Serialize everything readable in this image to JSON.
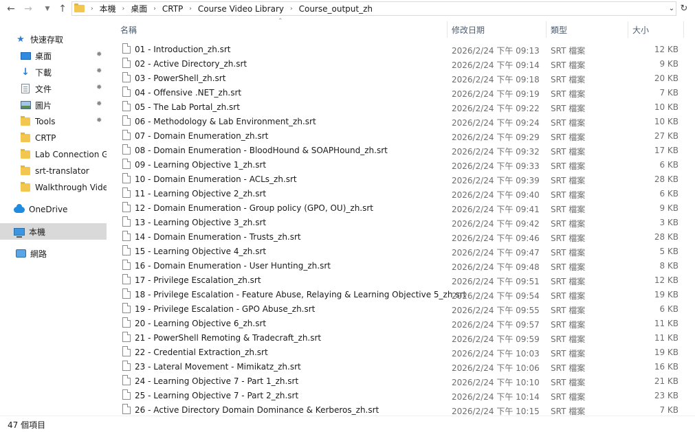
{
  "address_bar": {
    "back_icon": "arrow-left-icon",
    "forward_icon": "arrow-right-icon",
    "recent_icon": "chevron-down-icon",
    "up_icon": "arrow-up-icon",
    "breadcrumbs": [
      "本機",
      "桌面",
      "CRTP",
      "Course Video Library",
      "Course_output_zh"
    ]
  },
  "sidebar": {
    "items": [
      {
        "label": "快速存取",
        "icon": "star-icon",
        "pinned": false
      },
      {
        "label": "桌面",
        "icon": "desktop-icon",
        "pinned": true
      },
      {
        "label": "下載",
        "icon": "download-icon",
        "pinned": true
      },
      {
        "label": "文件",
        "icon": "documents-icon",
        "pinned": true
      },
      {
        "label": "圖片",
        "icon": "pictures-icon",
        "pinned": true
      },
      {
        "label": "Tools",
        "icon": "folder-icon",
        "pinned": true
      },
      {
        "label": "CRTP",
        "icon": "folder-icon",
        "pinned": false
      },
      {
        "label": "Lab Connection Gu",
        "icon": "folder-icon",
        "pinned": false
      },
      {
        "label": "srt-translator",
        "icon": "folder-icon",
        "pinned": false
      },
      {
        "label": "Walkthrough Vide",
        "icon": "folder-icon",
        "pinned": false
      },
      {
        "label": "OneDrive",
        "icon": "onedrive-icon",
        "pinned": false
      },
      {
        "label": "本機",
        "icon": "this-pc-icon",
        "pinned": false,
        "selected": true
      },
      {
        "label": "網路",
        "icon": "network-icon",
        "pinned": false
      }
    ]
  },
  "columns": {
    "name": "名稱",
    "modified": "修改日期",
    "type": "類型",
    "size": "大小"
  },
  "files": [
    {
      "name": "01 - Introduction_zh.srt",
      "modified": "2026/2/24 下午 09:13",
      "type": "SRT 檔案",
      "size": "12 KB"
    },
    {
      "name": "02 - Active Directory_zh.srt",
      "modified": "2026/2/24 下午 09:14",
      "type": "SRT 檔案",
      "size": "9 KB"
    },
    {
      "name": "03 - PowerShell_zh.srt",
      "modified": "2026/2/24 下午 09:18",
      "type": "SRT 檔案",
      "size": "20 KB"
    },
    {
      "name": "04 - Offensive .NET_zh.srt",
      "modified": "2026/2/24 下午 09:19",
      "type": "SRT 檔案",
      "size": "7 KB"
    },
    {
      "name": "05 - The Lab Portal_zh.srt",
      "modified": "2026/2/24 下午 09:22",
      "type": "SRT 檔案",
      "size": "10 KB"
    },
    {
      "name": "06 - Methodology & Lab Environment_zh.srt",
      "modified": "2026/2/24 下午 09:24",
      "type": "SRT 檔案",
      "size": "10 KB"
    },
    {
      "name": "07 - Domain Enumeration_zh.srt",
      "modified": "2026/2/24 下午 09:29",
      "type": "SRT 檔案",
      "size": "27 KB"
    },
    {
      "name": "08 - Domain Enumeration - BloodHound & SOAPHound_zh.srt",
      "modified": "2026/2/24 下午 09:32",
      "type": "SRT 檔案",
      "size": "17 KB"
    },
    {
      "name": "09 - Learning Objective 1_zh.srt",
      "modified": "2026/2/24 下午 09:33",
      "type": "SRT 檔案",
      "size": "6 KB"
    },
    {
      "name": "10 - Domain Enumeration - ACLs_zh.srt",
      "modified": "2026/2/24 下午 09:39",
      "type": "SRT 檔案",
      "size": "28 KB"
    },
    {
      "name": "11 - Learning Objective 2_zh.srt",
      "modified": "2026/2/24 下午 09:40",
      "type": "SRT 檔案",
      "size": "6 KB"
    },
    {
      "name": "12 - Domain Enumeration - Group policy (GPO, OU)_zh.srt",
      "modified": "2026/2/24 下午 09:41",
      "type": "SRT 檔案",
      "size": "9 KB"
    },
    {
      "name": "13 - Learning Objective 3_zh.srt",
      "modified": "2026/2/24 下午 09:42",
      "type": "SRT 檔案",
      "size": "3 KB"
    },
    {
      "name": "14 - Domain Enumeration - Trusts_zh.srt",
      "modified": "2026/2/24 下午 09:46",
      "type": "SRT 檔案",
      "size": "28 KB"
    },
    {
      "name": "15 - Learning Objective 4_zh.srt",
      "modified": "2026/2/24 下午 09:47",
      "type": "SRT 檔案",
      "size": "5 KB"
    },
    {
      "name": "16 - Domain Enumeration - User Hunting_zh.srt",
      "modified": "2026/2/24 下午 09:48",
      "type": "SRT 檔案",
      "size": "8 KB"
    },
    {
      "name": "17 - Privilege Escalation_zh.srt",
      "modified": "2026/2/24 下午 09:51",
      "type": "SRT 檔案",
      "size": "12 KB"
    },
    {
      "name": "18 - Privilege Escalation - Feature Abuse, Relaying & Learning Objective 5_zh.srt",
      "modified": "2026/2/24 下午 09:54",
      "type": "SRT 檔案",
      "size": "19 KB"
    },
    {
      "name": "19 - Privilege Escalation - GPO Abuse_zh.srt",
      "modified": "2026/2/24 下午 09:55",
      "type": "SRT 檔案",
      "size": "6 KB"
    },
    {
      "name": "20 - Learning Objective 6_zh.srt",
      "modified": "2026/2/24 下午 09:57",
      "type": "SRT 檔案",
      "size": "11 KB"
    },
    {
      "name": "21 - PowerShell Remoting & Tradecraft_zh.srt",
      "modified": "2026/2/24 下午 09:59",
      "type": "SRT 檔案",
      "size": "11 KB"
    },
    {
      "name": "22 - Credential Extraction_zh.srt",
      "modified": "2026/2/24 下午 10:03",
      "type": "SRT 檔案",
      "size": "19 KB"
    },
    {
      "name": "23 - Lateral Movement - Mimikatz_zh.srt",
      "modified": "2026/2/24 下午 10:06",
      "type": "SRT 檔案",
      "size": "16 KB"
    },
    {
      "name": "24 - Learning Objective 7 - Part 1_zh.srt",
      "modified": "2026/2/24 下午 10:10",
      "type": "SRT 檔案",
      "size": "21 KB"
    },
    {
      "name": "25 - Learning Objective 7 - Part 2_zh.srt",
      "modified": "2026/2/24 下午 10:14",
      "type": "SRT 檔案",
      "size": "23 KB"
    },
    {
      "name": "26 - Active Directory Domain Dominance & Kerberos_zh.srt",
      "modified": "2026/2/24 下午 10:15",
      "type": "SRT 檔案",
      "size": "7 KB"
    }
  ],
  "status": {
    "item_count": "47 個項目"
  }
}
